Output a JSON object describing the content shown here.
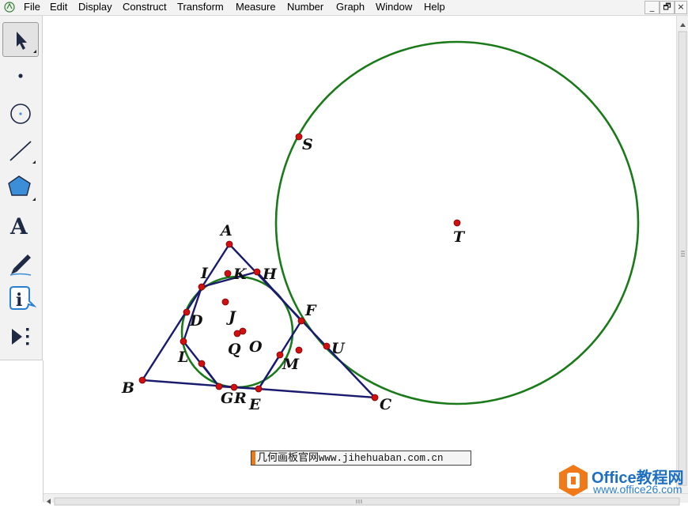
{
  "menu": [
    "File",
    "Edit",
    "Display",
    "Construct",
    "Transform",
    "Measure",
    "Number",
    "Graph",
    "Window",
    "Help"
  ],
  "window_controls": {
    "minimize": "_",
    "restore": "🗗",
    "close": "×"
  },
  "tools": [
    {
      "name": "selection-arrow-tool",
      "icon": "arrow-icon",
      "selected": true
    },
    {
      "name": "point-tool",
      "icon": "point-icon"
    },
    {
      "name": "compass-tool",
      "icon": "circle-icon"
    },
    {
      "name": "straightedge-tool",
      "icon": "line-icon"
    },
    {
      "name": "polygon-tool",
      "icon": "pentagon-icon"
    },
    {
      "name": "text-tool",
      "icon": "text-icon",
      "glyph": "A"
    },
    {
      "name": "marker-tool",
      "icon": "pen-icon"
    },
    {
      "name": "information-tool",
      "icon": "info-icon",
      "glyph": "i"
    },
    {
      "name": "custom-tool",
      "icon": "custom-tools-icon"
    }
  ],
  "points": {
    "A": "A",
    "B": "B",
    "C": "C",
    "D": "D",
    "E": "E",
    "F": "F",
    "G": "G",
    "H": "H",
    "I": "I",
    "J": "J",
    "K": "K",
    "L": "L",
    "M": "M",
    "O": "O",
    "Q": "Q",
    "R": "R",
    "S": "S",
    "T": "T",
    "U": "U"
  },
  "colors": {
    "triangle": "#1a1a6e",
    "circle": "#1a7a1a",
    "point": "#d01010"
  },
  "caption": {
    "chinese": "几何画板官网",
    "url": "www.jihehuaban.com.cn"
  },
  "watermark": {
    "brand": "Office教程网",
    "url": "www.office26.com"
  }
}
